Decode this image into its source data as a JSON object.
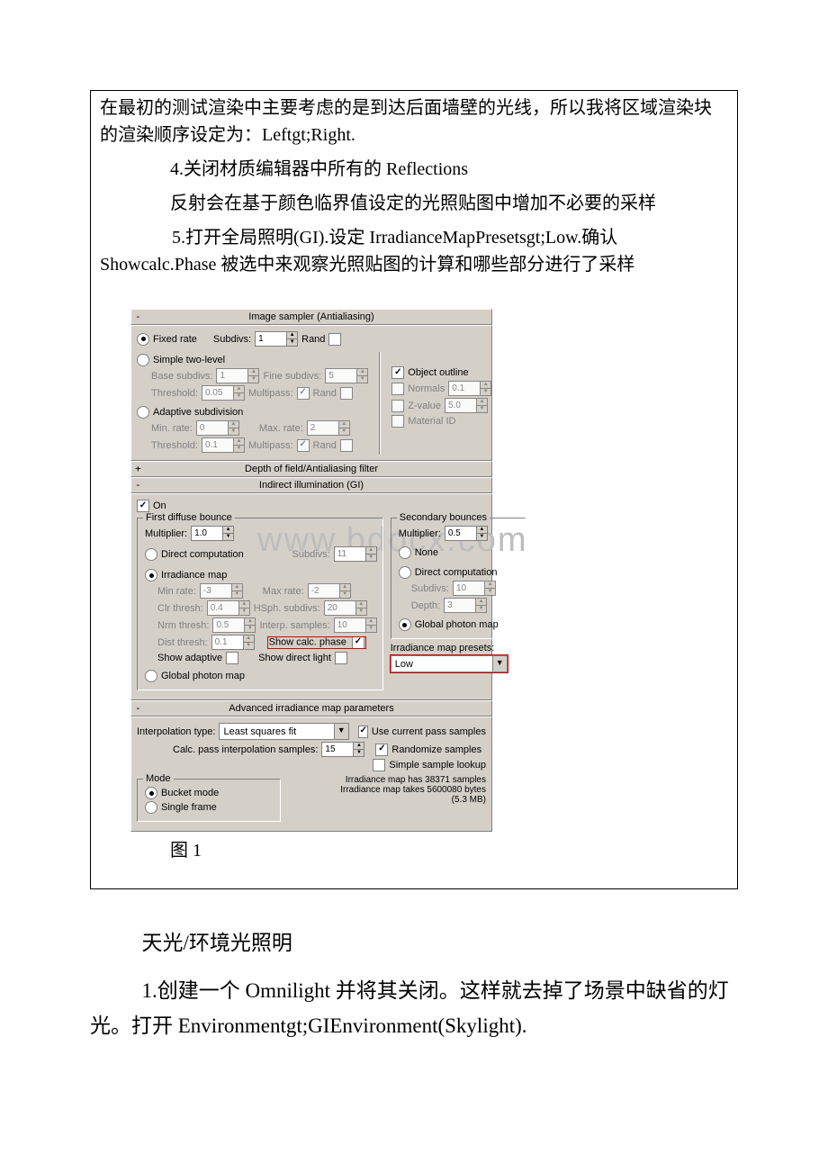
{
  "doc": {
    "p1": "在最初的测试渲染中主要考虑的是到达后面墙壁的光线，所以我将区域渲染块的渲染顺序设定为：Leftgt;Right.",
    "p2": "4.关闭材质编辑器中所有的 Reflections",
    "p3": "反射会在基于颜色临界值设定的光照贴图中增加不必要的采样",
    "p4": "5.打开全局照明(GI).设定 IrradianceMapPresetsgt;Low.确认Showcalc.Phase 被选中来观察光照贴图的计算和哪些部分进行了采样",
    "figLabel": "图 1",
    "below1": "天光/环境光照明",
    "below2": "1.创建一个 Omnilight 并将其关闭。这样就去掉了场景中缺省的灯光。打开 Environmentgt;GIEnvironment(Skylight)."
  },
  "watermark": "www.bdocx.com",
  "rollouts": {
    "antialias": {
      "title": "Image sampler (Antialiasing)",
      "fixedRate": "Fixed rate",
      "subdivsLbl": "Subdivs:",
      "subdivsVal": "1",
      "randLbl": "Rand",
      "simpleTwoLevel": "Simple two-level",
      "baseSubdivsLbl": "Base subdivs:",
      "baseSubdivsVal": "1",
      "fineSubdivsLbl": "Fine subdivs:",
      "fineSubdivsVal": "5",
      "thresholdLbl": "Threshold:",
      "thresholdVal": "0.05",
      "multipassLbl": "Multipass:",
      "objectOutline": "Object outline",
      "normalsLbl": "Normals",
      "normalsVal": "0.1",
      "zvalueLbl": "Z-value",
      "zvalueVal": "5.0",
      "materialId": "Material ID",
      "adaptive": "Adaptive subdivision",
      "minRateLbl": "Min. rate:",
      "minRateVal": "0",
      "maxRateLbl": "Max. rate:",
      "maxRateVal": "2",
      "threshold2Val": "0.1"
    },
    "dof": {
      "title": "Depth of field/Antialiasing filter"
    },
    "gi": {
      "title": "Indirect illumination (GI)",
      "on": "On",
      "firstBounce": "First diffuse bounce",
      "multiplierLbl": "Multiplier:",
      "multiplier1": "1.0",
      "directComp": "Direct computation",
      "subdivsLbl": "Subdivs:",
      "subdivsVal": "11",
      "irrMap": "Irradiance map",
      "minRateLbl": "Min rate:",
      "minRateVal": "-3",
      "maxRateLbl": "Max rate:",
      "maxRateVal": "-2",
      "clrThreshLbl": "Clr thresh:",
      "clrThreshVal": "0.4",
      "hsphLbl": "HSph. subdivs:",
      "hsphVal": "20",
      "nrmThreshLbl": "Nrm thresh:",
      "nrmThreshVal": "0.5",
      "interpLbl": "Interp. samples:",
      "interpVal": "10",
      "distThreshLbl": "Dist thresh:",
      "distThreshVal": "0.1",
      "showCalc": "Show calc. phase",
      "showAdaptive": "Show adaptive",
      "showDirect": "Show direct light",
      "globalPhoton": "Global photon map",
      "secondary": "Secondary bounces",
      "multiplier2": "0.5",
      "none": "None",
      "directCompSubdivs": "10",
      "depthLbl": "Depth:",
      "depthVal": "3",
      "presetsLbl": "Irradiance map presets:",
      "presetsVal": "Low"
    },
    "adv": {
      "title": "Advanced irradiance map parameters",
      "interpTypeLbl": "Interpolation type:",
      "interpTypeVal": "Least squares fit",
      "calcPassLbl": "Calc. pass interpolation samples:",
      "calcPassVal": "15",
      "useCurrent": "Use current pass samples",
      "randomize": "Randomize samples",
      "simpleLookup": "Simple sample lookup",
      "mode": "Mode",
      "bucket": "Bucket mode",
      "singleFrame": "Single frame",
      "info1": "Irradiance map has 38371 samples",
      "info2": "Irradiance map takes 5600080 bytes",
      "info3": "(5.3 MB)"
    }
  }
}
